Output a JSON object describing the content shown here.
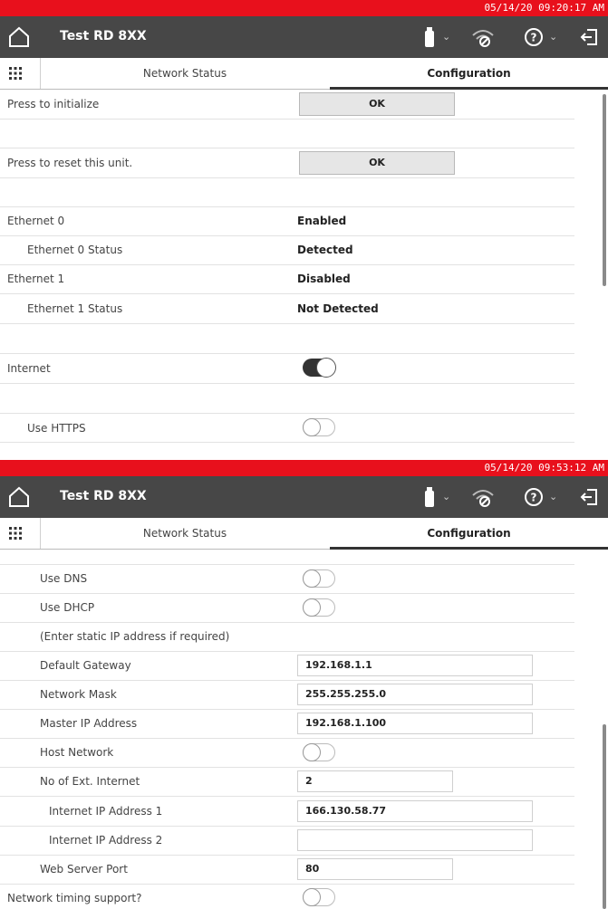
{
  "panel1": {
    "datetime": "05/14/20 09:20:17 AM",
    "title": "Test RD 8XX",
    "tabs": {
      "network_status": "Network Status",
      "configuration": "Configuration"
    },
    "rows": {
      "init_label": "Press to initialize",
      "init_btn": "OK",
      "reset_label": "Press to reset this unit.",
      "reset_btn": "OK",
      "eth0_label": "Ethernet 0",
      "eth0_value": "Enabled",
      "eth0_status_label": "Ethernet 0 Status",
      "eth0_status_value": "Detected",
      "eth1_label": "Ethernet 1",
      "eth1_value": "Disabled",
      "eth1_status_label": "Ethernet 1 Status",
      "eth1_status_value": "Not Detected",
      "internet_label": "Internet",
      "internet_on": true,
      "https_label": "Use HTTPS",
      "https_on": false
    }
  },
  "panel2": {
    "datetime": "05/14/20 09:53:12 AM",
    "title": "Test RD 8XX",
    "tabs": {
      "network_status": "Network Status",
      "configuration": "Configuration"
    },
    "rows": {
      "dns_label": "Use DNS",
      "dhcp_label": "Use DHCP",
      "static_note": "(Enter static IP address if required)",
      "gateway_label": "Default Gateway",
      "gateway_value": "192.168.1.1",
      "mask_label": "Network Mask",
      "mask_value": "255.255.255.0",
      "master_label": "Master IP Address",
      "master_value": "192.168.1.100",
      "host_label": "Host Network",
      "ext_label": "No of Ext. Internet",
      "ext_value": "2",
      "ip1_label": "Internet IP Address 1",
      "ip1_value": "166.130.58.77",
      "ip2_label": "Internet IP Address 2",
      "ip2_value": "",
      "port_label": "Web Server Port",
      "port_value": "80",
      "timing_label": "Network timing support?"
    }
  },
  "icons": [
    "home-icon",
    "usb-icon",
    "signal-off-icon",
    "help-icon",
    "exit-icon",
    "grid-menu-icon",
    "chevron-down-icon"
  ]
}
